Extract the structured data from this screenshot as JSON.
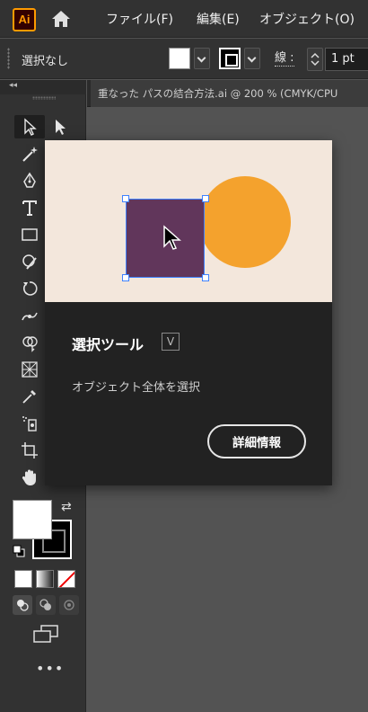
{
  "menubar": {
    "logo": "Ai",
    "icons": [
      "ai-logo-icon",
      "home-icon"
    ],
    "items": [
      "ファイル(F)",
      "編集(E)",
      "オブジェクト(O)"
    ]
  },
  "controlbar": {
    "selection_label": "選択なし",
    "stroke_label": "線 :",
    "stroke_weight": "1 pt",
    "fill_color": "#ffffff",
    "stroke_color": "#000000"
  },
  "document": {
    "tab_title": "重なった パスの結合方法.ai @ 200 % (CMYK/CPU"
  },
  "tooltip": {
    "title": "選択ツール",
    "shortcut": "V",
    "description": "オブジェクト全体を選択",
    "button_label": "詳細情報",
    "illustration_colors": {
      "background": "#f3e7dc",
      "square": "#61365b",
      "circle": "#f4a22d",
      "selection": "#3f82ff"
    }
  },
  "toolbar": {
    "more_label": "•••"
  },
  "colors": {
    "app_bg": "#323232",
    "canvas_bg": "#535353",
    "accent": "#ff9a00"
  }
}
